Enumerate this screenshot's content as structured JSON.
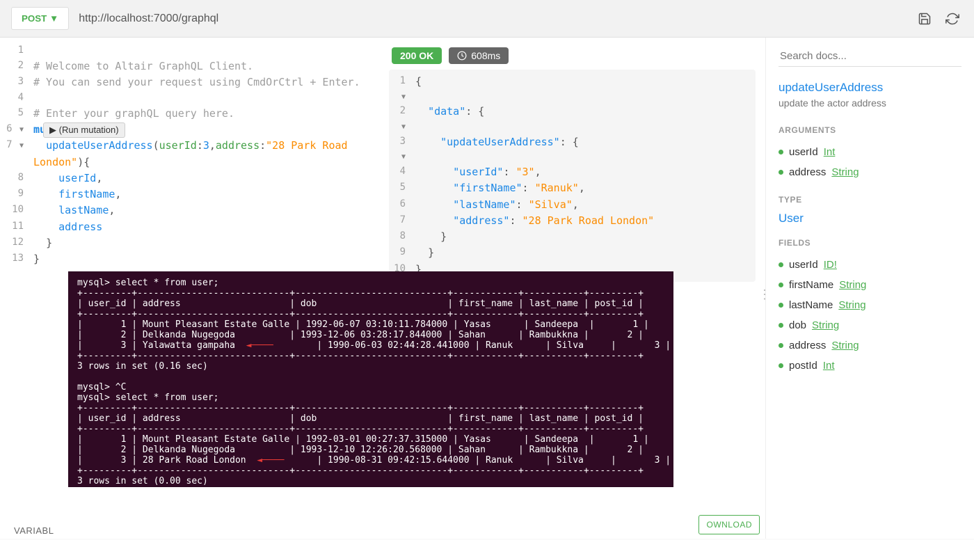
{
  "topbar": {
    "method": "POST ▼",
    "url": "http://localhost:7000/graphql"
  },
  "editor": {
    "lines": {
      "l1": "",
      "l2": "# Welcome to Altair GraphQL Client.",
      "l3": "# You can send your request using CmdOrCtrl + Enter.",
      "l4": "",
      "l5": "# Enter your graphQL query here.",
      "l6_kw": "mutation",
      "l7_field": "updateUserAddress",
      "l7_arg1": "userId",
      "l7_val1": "3",
      "l7_arg2": "address",
      "l7_val2": "\"28 Park Road London\"",
      "l8": "userId",
      "l9": "firstName",
      "l10": "lastName",
      "l11": "address"
    },
    "run_label": "▶ (Run mutation)",
    "variables_label": "VARIABL"
  },
  "result": {
    "status": "200 OK",
    "time": "608ms",
    "json": {
      "data_k": "\"data\"",
      "upd_k": "\"updateUserAddress\"",
      "userId_k": "\"userId\"",
      "userId_v": "\"3\"",
      "firstName_k": "\"firstName\"",
      "firstName_v": "\"Ranuk\"",
      "lastName_k": "\"lastName\"",
      "lastName_v": "\"Silva\"",
      "address_k": "\"address\"",
      "address_v": "\"28 Park Road London\""
    },
    "download_label": "OWNLOAD"
  },
  "terminal": {
    "t1": "mysql> select * from user;",
    "t2": "+---------+----------------------------+----------------------------+------------+-----------+---------+",
    "t3": "| user_id | address                    | dob                        | first_name | last_name | post_id |",
    "t4": "+---------+----------------------------+----------------------------+------------+-----------+---------+",
    "t5": "|       1 | Mount Pleasant Estate Galle | 1992-06-07 03:10:11.784000 | Yasas      | Sandeepa  |       1 |",
    "t6": "|       2 | Delkanda Nugegoda          | 1993-12-06 03:28:17.844000 | Sahan      | Rambukkna |       2 |",
    "t7a": "|       3 | Yalawatta gampaha  ",
    "t7b": "        | 1990-06-03 02:44:28.441000 | Ranuk      | Silva     |       3 |",
    "t8": "+---------+----------------------------+----------------------------+------------+-----------+---------+",
    "t9": "3 rows in set (0.16 sec)",
    "t10": "",
    "t11": "mysql> ^C",
    "t12": "mysql> select * from user;",
    "t13": "+---------+----------------------------+----------------------------+------------+-----------+---------+",
    "t14": "| user_id | address                    | dob                        | first_name | last_name | post_id |",
    "t15": "+---------+----------------------------+----------------------------+------------+-----------+---------+",
    "t16": "|       1 | Mount Pleasant Estate Galle | 1992-03-01 00:27:37.315000 | Yasas      | Sandeepa  |       1 |",
    "t17": "|       2 | Delkanda Nugegoda          | 1993-12-10 12:26:20.568000 | Sahan      | Rambukkna |       2 |",
    "t18a": "|       3 | 28 Park Road London  ",
    "t18b": "      | 1990-08-31 09:42:15.644000 | Ranuk      | Silva     |       3 |",
    "t19": "+---------+----------------------------+----------------------------+------------+-----------+---------+",
    "t20": "3 rows in set (0.00 sec)",
    "arrow": "◄────"
  },
  "docs": {
    "search_ph": "Search docs...",
    "title": "updateUserAddress",
    "subtitle": "update the actor address",
    "sections": {
      "arguments": "ARGUMENTS",
      "type": "TYPE",
      "fields": "FIELDS"
    },
    "type_link": "User",
    "args": [
      {
        "name": "userId",
        "type": "Int"
      },
      {
        "name": "address",
        "type": "String"
      }
    ],
    "fields": [
      {
        "name": "userId",
        "type": "ID!"
      },
      {
        "name": "firstName",
        "type": "String"
      },
      {
        "name": "lastName",
        "type": "String"
      },
      {
        "name": "dob",
        "type": "String"
      },
      {
        "name": "address",
        "type": "String"
      },
      {
        "name": "postId",
        "type": "Int"
      }
    ]
  }
}
